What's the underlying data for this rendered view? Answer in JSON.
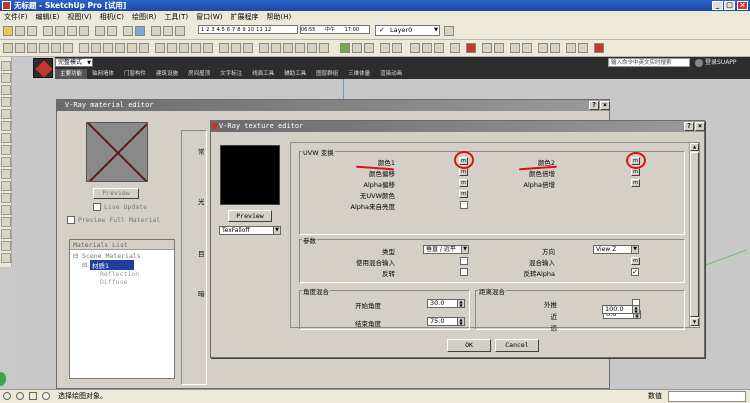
{
  "app": {
    "title": "无标题 - SketchUp Pro [试用]"
  },
  "menu": [
    "文件(F)",
    "编辑(E)",
    "视图(V)",
    "相机(C)",
    "绘图(R)",
    "工具(T)",
    "窗口(W)",
    "扩展程序",
    "帮助(H)"
  ],
  "toolbar": {
    "ruler_numbers": "1 2 3 4 5 6 7 8 9 10 11 12",
    "time_start": "06:55",
    "time_mid": "中午",
    "time_end": "17:00",
    "layer": "Layer0"
  },
  "chinese_bar": {
    "mode": "完整模式",
    "tabs": [
      "主要功能",
      "轴网墙体",
      "门窗构件",
      "建筑设施",
      "房间屋顶",
      "文字标注",
      "线面工具",
      "辅助工具",
      "图层群组",
      "三维体量",
      "渲染动画"
    ],
    "command_placeholder": "输入命令中英文实时搜索",
    "login": "登录SUAPP"
  },
  "material_editor": {
    "title": "V-Ray material editor",
    "preview_button": "Preview",
    "live_update": "Live Update",
    "preview_full": "Preview Full Material",
    "list_header": "Materials List",
    "scene_materials": "Scene Materials",
    "material_name": "材质1",
    "reflection": "Reflection",
    "diffuse": "Diffuse",
    "side_label_1": "常",
    "side_label_2": "光",
    "side_label_3": "目",
    "side_label_4": "暗"
  },
  "texture_editor": {
    "title": "V-Ray texture editor",
    "preview_button": "Preview",
    "texture_type": "TexFalloff",
    "uvw_section": "UVW 变换",
    "color1": "颜色1",
    "color2": "颜色2",
    "color_offset": "颜色偏移",
    "color_multiplier": "颜色倍增",
    "alpha_offset": "Alpha偏移",
    "alpha_multiplier": "Alpha倍增",
    "no_uvw_color": "无UVW颜色",
    "alpha_from_lum": "Alpha来自亮度",
    "params_section": "参数",
    "type_label": "类型",
    "type_value": "垂直 / 远平",
    "direction_label": "方向",
    "direction_value": "View Z",
    "use_blend_input": "使用混合输入",
    "blend_input": "混合输入",
    "invert": "反转",
    "invert_alpha": "反转Alpha",
    "angle_blend": "角度混合",
    "start_angle": "开始角度",
    "start_angle_value": "30.0",
    "end_angle": "结束角度",
    "end_angle_value": "75.0",
    "distance_blend": "距离混合",
    "extrapolate": "外推",
    "near": "近",
    "near_value": "0.0",
    "far": "远",
    "far_value": "100.0",
    "ok": "OK",
    "cancel": "Cancel",
    "map_button": "m",
    "checkmark": "✓"
  },
  "status": {
    "text": "选择绘图对象。",
    "measure_label": "数值"
  },
  "colors": {
    "title_blue": "#1a49a8",
    "highlight_red": "#e01010",
    "dialog_bg": "#d4d0c8",
    "dialog_title": "#6b6b6b"
  }
}
